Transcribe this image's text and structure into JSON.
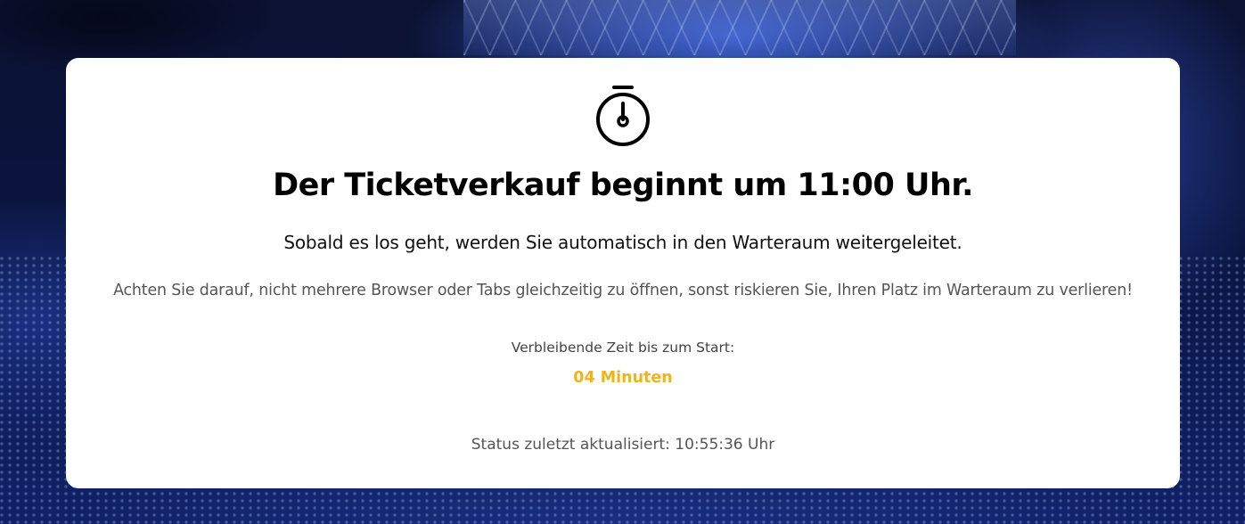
{
  "page": {
    "background": "concert-crowd-blue-stage",
    "headline": "Der Ticketverkauf beginnt um 11:00 Uhr.",
    "subline": "Sobald es los geht, werden Sie automatisch in den Warteraum weitergeleitet.",
    "warning": "Achten Sie darauf, nicht mehrere Browser oder Tabs gleichzeitig zu öffnen, sonst riskieren Sie, Ihren Platz im Warteraum zu verlieren!",
    "remaining_label": "Verbleibende Zeit bis zum Start:",
    "remaining_value": "04 Minuten",
    "status": "Status zuletzt aktualisiert: 10:55:36 Uhr",
    "icon": "stopwatch-icon"
  },
  "colors": {
    "accent": "#f0b418",
    "card": "#ffffff",
    "text": "#000000"
  }
}
